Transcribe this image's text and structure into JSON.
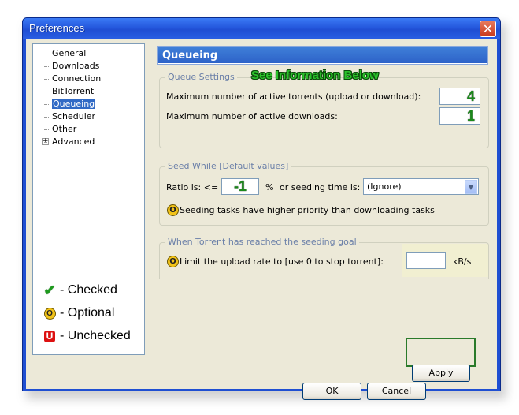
{
  "window": {
    "title": "Preferences"
  },
  "sidebar": {
    "items": [
      {
        "label": "General"
      },
      {
        "label": "Downloads"
      },
      {
        "label": "Connection"
      },
      {
        "label": "BitTorrent"
      },
      {
        "label": "Queueing",
        "selected": true
      },
      {
        "label": "Scheduler"
      },
      {
        "label": "Other"
      },
      {
        "label": "Advanced",
        "expandable": true
      }
    ],
    "legend": [
      {
        "icon": "checkmark-icon",
        "symbol": "✔",
        "label": "- Checked"
      },
      {
        "icon": "optional-icon",
        "symbol": "O",
        "label": "- Optional"
      },
      {
        "icon": "unchecked-icon",
        "symbol": "U",
        "label": "- Unchecked"
      }
    ]
  },
  "panel": {
    "header": "Queueing",
    "queue_settings": {
      "title": "Queue Settings",
      "note": "See Information Below",
      "max_active_torrents_label": "Maximum number of active torrents (upload or download):",
      "max_active_torrents_value": "4",
      "max_active_downloads_label": "Maximum number of active downloads:",
      "max_active_downloads_value": "1"
    },
    "seed_while": {
      "title": "Seed While [Default values]",
      "ratio_label": "Ratio is:  <=",
      "ratio_value": "-1",
      "percent_label": "%",
      "seeding_time_label": "or seeding time is:",
      "seeding_time_value": "(Ignore)",
      "priority_option_icon": "O",
      "priority_label": "Seeding tasks have higher priority than downloading tasks"
    },
    "seeding_goal": {
      "title": "When Torrent has reached the seeding goal",
      "limit_option_icon": "O",
      "limit_label": "Limit the upload rate to [use 0 to stop torrent]:",
      "limit_value": "",
      "unit": "kB/s"
    }
  },
  "buttons": {
    "ok": "OK",
    "cancel": "Cancel",
    "apply": "Apply"
  },
  "colors": {
    "title_bar": "#2457dd",
    "selected": "#316ac5",
    "note_green": "#2bc12b",
    "apply_frame": "#2a7a2a"
  }
}
